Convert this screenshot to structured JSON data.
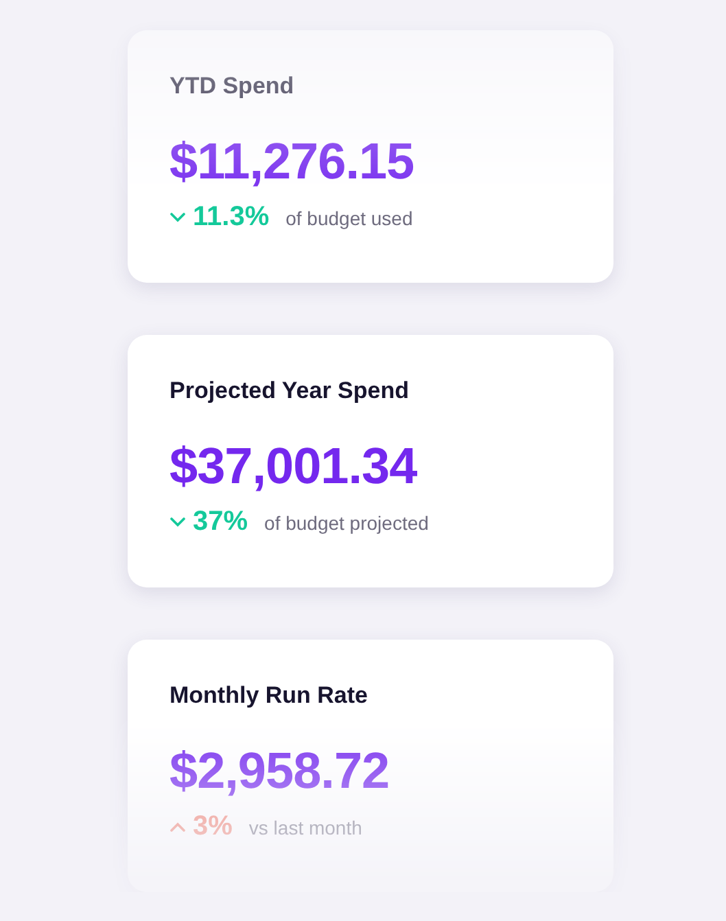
{
  "cards": [
    {
      "title": "YTD Spend",
      "amount": "$11,276.15",
      "trend": {
        "kind": "down",
        "value": "11.3%",
        "note": "of budget used"
      }
    },
    {
      "title": "Projected Year Spend",
      "amount": "$37,001.34",
      "trend": {
        "kind": "down",
        "value": "37%",
        "note": "of budget projected"
      }
    },
    {
      "title": "Monthly Run Rate",
      "amount": "$2,958.72",
      "trend": {
        "kind": "up",
        "value": "3%",
        "note": "vs last month"
      }
    }
  ]
}
